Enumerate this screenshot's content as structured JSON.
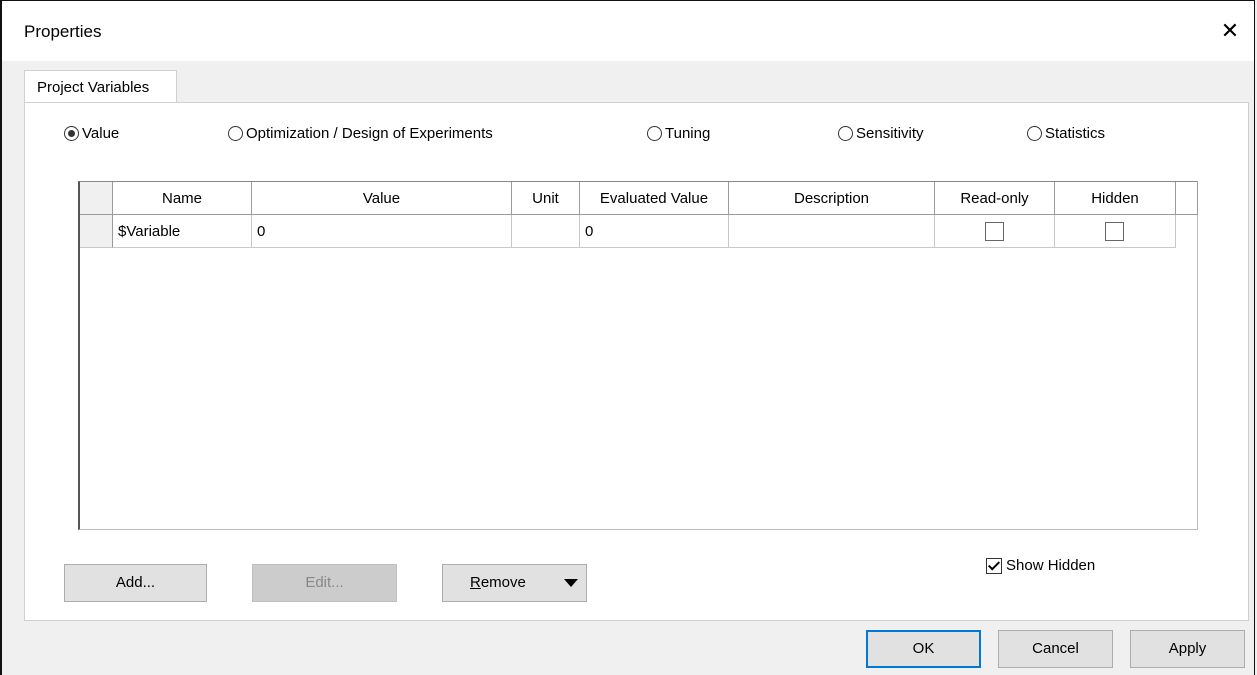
{
  "window": {
    "title": "Properties",
    "close_glyph": "✕"
  },
  "tabs": [
    {
      "label": "Project Variables"
    }
  ],
  "modes": [
    {
      "label": "Value",
      "selected": true
    },
    {
      "label": "Optimization / Design of Experiments",
      "selected": false
    },
    {
      "label": "Tuning",
      "selected": false
    },
    {
      "label": "Sensitivity",
      "selected": false
    },
    {
      "label": "Statistics",
      "selected": false
    }
  ],
  "table": {
    "columns": [
      "Name",
      "Value",
      "Unit",
      "Evaluated Value",
      "Description",
      "Read-only",
      "Hidden"
    ],
    "rows": [
      {
        "name": "$Variable",
        "value": "0",
        "unit": "",
        "evaluated": "0",
        "description": "",
        "read_only": false,
        "hidden": false
      }
    ]
  },
  "actions": {
    "add": "Add...",
    "edit": "Edit...",
    "remove_rest": "emove",
    "remove_mnemonic": "R"
  },
  "show_hidden": {
    "label": "Show Hidden",
    "checked": true
  },
  "footer": {
    "ok": "OK",
    "cancel": "Cancel",
    "apply": "Apply"
  }
}
